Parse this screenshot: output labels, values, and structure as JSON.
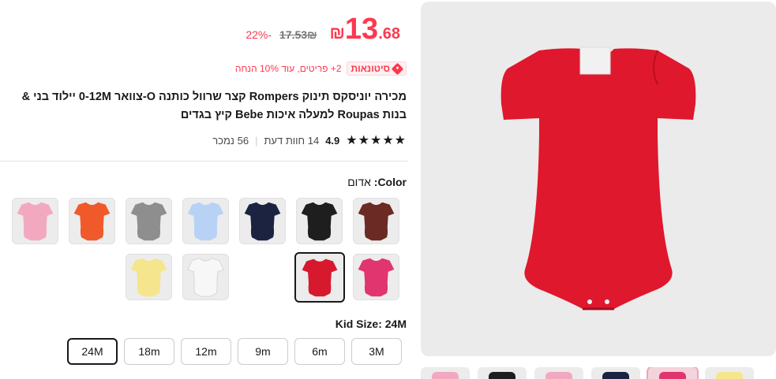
{
  "price": {
    "integer": "13",
    "fraction": ".68",
    "currency": "₪",
    "original": "17.53₪",
    "discount": "22%-"
  },
  "promo": {
    "badge_label": "סיטונאות",
    "text": "2+ פריטים, עוד 10% הנחה"
  },
  "product": {
    "title": "מכירה יוניסקס תינוק Rompers קצר שרוול כותנה O-צוואר 0-12M יילוד בני & בנות Roupas למעלה איכות Bebe קיץ בגדים"
  },
  "rating": {
    "stars": "★★★★★",
    "score": "4.9",
    "reviews": "14 חוות דעת",
    "separator": "|",
    "sold": "56 נמכר"
  },
  "color": {
    "label": "Color",
    "selected": "אדום",
    "options": [
      {
        "name": "brown",
        "hex": "#6b2a24"
      },
      {
        "name": "black",
        "hex": "#1e1e1e"
      },
      {
        "name": "navy",
        "hex": "#1c2340"
      },
      {
        "name": "light-blue",
        "hex": "#b8d2f5"
      },
      {
        "name": "gray",
        "hex": "#8e8e8e"
      },
      {
        "name": "orange",
        "hex": "#f05a2a"
      },
      {
        "name": "pink",
        "hex": "#f2a9c0"
      },
      {
        "name": "rose",
        "hex": "#e0356e"
      },
      {
        "name": "red",
        "hex": "#d7192e"
      },
      {
        "name": "white",
        "hex": "#f7f7f7"
      },
      {
        "name": "yellow",
        "hex": "#f5e58c"
      }
    ]
  },
  "size": {
    "label": "Kid Size",
    "selected": "24M",
    "options": [
      "3M",
      "6m",
      "9m",
      "12m",
      "18m",
      "24M"
    ]
  },
  "gallery": {
    "main_color": "#e0182d",
    "thumb_colors": [
      "#f2a9c0",
      "#1e1e1e",
      "#f2a9c0",
      "#1c2340",
      "#e0356e",
      "#f5e58c"
    ]
  }
}
